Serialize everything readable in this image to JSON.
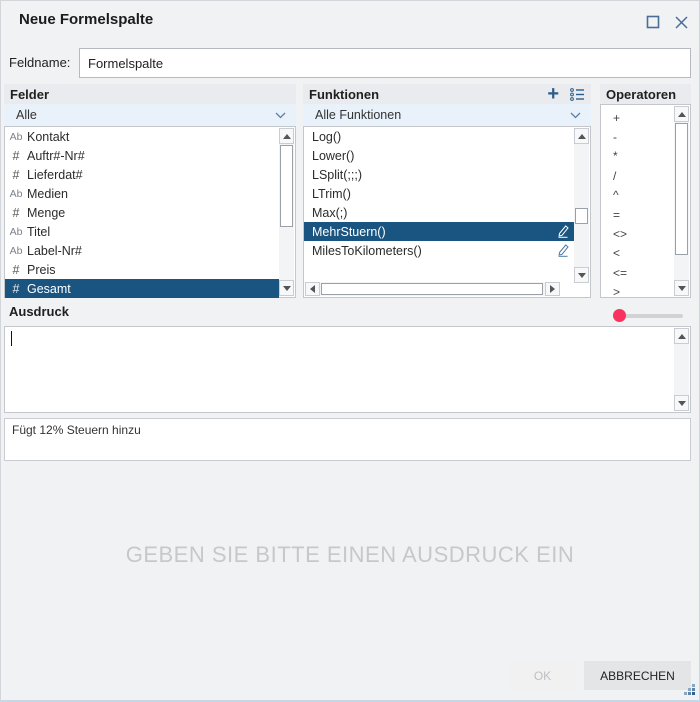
{
  "window": {
    "title": "Neue Formelspalte"
  },
  "field_name": {
    "label": "Feldname:",
    "value": "Formelspalte"
  },
  "panels": {
    "felder": {
      "header": "Felder",
      "filter": "Alle",
      "items": [
        {
          "type": "Ab",
          "label": "Kontakt",
          "selected": false
        },
        {
          "type": "#",
          "label": "Auftr#-Nr#",
          "selected": false
        },
        {
          "type": "#",
          "label": "Lieferdat#",
          "selected": false
        },
        {
          "type": "Ab",
          "label": "Medien",
          "selected": false
        },
        {
          "type": "#",
          "label": "Menge",
          "selected": false
        },
        {
          "type": "Ab",
          "label": "Titel",
          "selected": false
        },
        {
          "type": "Ab",
          "label": "Label-Nr#",
          "selected": false
        },
        {
          "type": "#",
          "label": "Preis",
          "selected": false
        },
        {
          "type": "#",
          "label": "Gesamt",
          "selected": true
        }
      ]
    },
    "funktionen": {
      "header": "Funktionen",
      "filter": "Alle Funktionen",
      "items": [
        {
          "label": "Log()",
          "selected": false,
          "editable": false
        },
        {
          "label": "Lower()",
          "selected": false,
          "editable": false
        },
        {
          "label": "LSplit(;;;)",
          "selected": false,
          "editable": false
        },
        {
          "label": "LTrim()",
          "selected": false,
          "editable": false
        },
        {
          "label": "Max(;)",
          "selected": false,
          "editable": false
        },
        {
          "label": "MehrStuern()",
          "selected": true,
          "editable": true
        },
        {
          "label": "MilesToKilometers()",
          "selected": false,
          "editable": true
        }
      ]
    },
    "operatoren": {
      "header": "Operatoren",
      "items": [
        "+",
        "-",
        "*",
        "/",
        "^",
        "=",
        "<>",
        "<",
        "<=",
        ">"
      ]
    }
  },
  "ausdruck": {
    "header": "Ausdruck",
    "value": "",
    "description": "Fügt 12% Steuern hinzu"
  },
  "placeholder_text": "GEBEN SIE BITTE EINEN AUSDRUCK EIN",
  "buttons": {
    "ok": "OK",
    "cancel": "ABBRECHEN"
  },
  "colors": {
    "selection": "#1a5480",
    "slider_thumb": "#f8335f",
    "icon_blue": "#4a6d96"
  }
}
